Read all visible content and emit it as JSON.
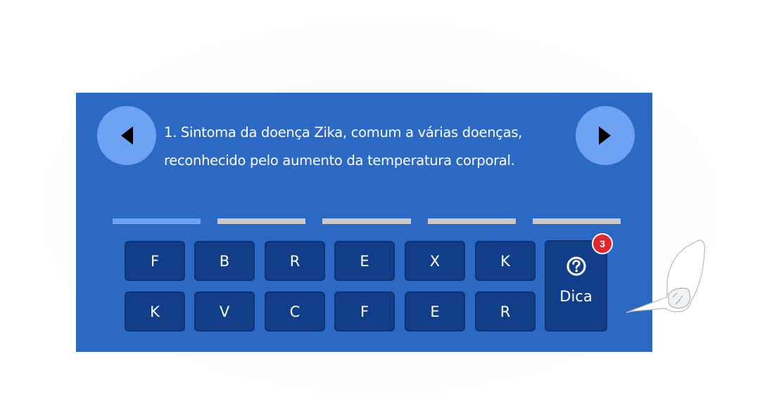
{
  "question": {
    "line1": "1. Sintoma da doença Zika, comum a várias doenças,",
    "line2": "reconhecido pelo aumento da temperatura corporal."
  },
  "navigation": {
    "prev_icon": "triangle-left-icon",
    "next_icon": "triangle-right-icon"
  },
  "answer_slots": {
    "count": 5,
    "active_index": 0
  },
  "keyboard": {
    "row1": [
      "F",
      "B",
      "R",
      "E",
      "X",
      "K"
    ],
    "row2": [
      "K",
      "V",
      "C",
      "F",
      "E",
      "R"
    ]
  },
  "hint": {
    "label": "Dica",
    "count": "3",
    "icon": "question-circle-icon"
  },
  "colors": {
    "panel": "#2b69c5",
    "nav_button": "#6ea2f2",
    "key": "#123d88",
    "slot_active": "#6ea2f2",
    "slot_inactive": "#c9c9c9",
    "badge": "#e0262f"
  }
}
